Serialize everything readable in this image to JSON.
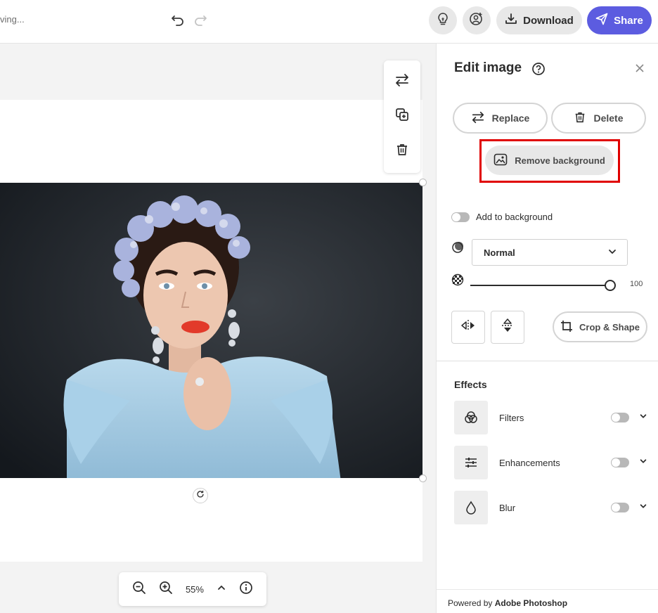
{
  "topbar": {
    "saving_text": "ving...",
    "download_label": "Download",
    "share_label": "Share",
    "accent": "#5c5ce0"
  },
  "canvas": {
    "zoom_level": "55%"
  },
  "panel": {
    "title": "Edit image",
    "replace_label": "Replace",
    "delete_label": "Delete",
    "remove_bg_label": "Remove background",
    "add_to_bg_label": "Add to background",
    "blend_mode": "Normal",
    "opacity_value": "100",
    "crop_label": "Crop & Shape",
    "effects_title": "Effects",
    "effects": [
      {
        "label": "Filters",
        "icon": "filters-icon"
      },
      {
        "label": "Enhancements",
        "icon": "sliders-icon"
      },
      {
        "label": "Blur",
        "icon": "drop-icon"
      }
    ],
    "footer_prefix": "Powered by ",
    "footer_brand": "Adobe Photoshop"
  }
}
